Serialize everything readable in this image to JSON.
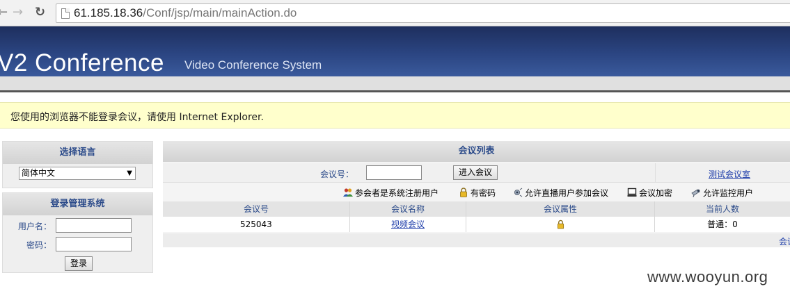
{
  "browser": {
    "url_host": "61.185.18.36",
    "url_path": "/Conf/jsp/main/mainAction.do"
  },
  "header": {
    "title": "V2 Conference",
    "subtitle": "Video Conference System"
  },
  "warning": {
    "text": "您使用的浏览器不能登录会议，请使用 Internet Explorer."
  },
  "language": {
    "heading": "选择语言",
    "selected": "简体中文"
  },
  "login": {
    "heading": "登录管理系统",
    "username_label": "用户名：",
    "password_label": "密码：",
    "button": "登录"
  },
  "conference": {
    "heading": "会议列表",
    "search_label": "会议号：",
    "enter_button": "进入会议",
    "test_room_link": "测试会议室",
    "legend": [
      {
        "icon": "users-icon",
        "label": "参会者是系统注册用户"
      },
      {
        "icon": "lock-icon",
        "label": "有密码"
      },
      {
        "icon": "broadcast-icon",
        "label": "允许直播用户参加会议"
      },
      {
        "icon": "monitor-icon",
        "label": "会议加密"
      },
      {
        "icon": "camera-icon",
        "label": "允许监控用户"
      }
    ],
    "columns": [
      "会议号",
      "会议名称",
      "会议属性",
      "当前人数"
    ],
    "rows": [
      {
        "id": "525043",
        "name": "视频会议",
        "attribute_icon": "lock-icon",
        "count": "普通：0"
      }
    ],
    "footer_text": "会议"
  },
  "watermark": "www.wooyun.org",
  "colors": {
    "banner": "#2b4582",
    "heading_text": "#2c4b8a",
    "link": "#1a3aa8",
    "warning_bg": "#ffffcc"
  }
}
